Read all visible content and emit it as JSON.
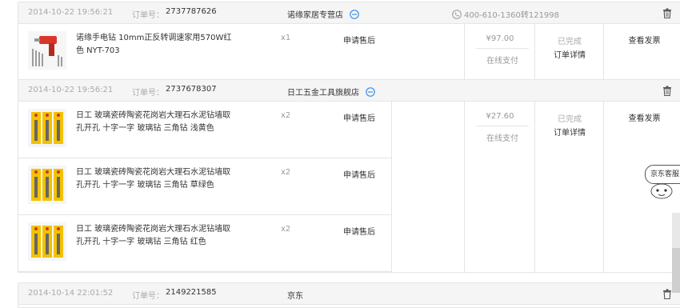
{
  "orders": [
    {
      "time": "2014-10-22 19:56:21",
      "order_label": "订单号：",
      "order_no": "2737787626",
      "shop": "诺缘家居专营店",
      "phone": "400-610-1360转121998",
      "items": [
        {
          "name": "诺缘手电钻 10mm正反转调速家用570W红色 NYT-703",
          "qty": "x1",
          "service": "申请售后"
        }
      ],
      "price": "¥97.00",
      "pay": "在线支付",
      "status": "已完成",
      "detail": "订单详情",
      "invoice": "查看发票"
    },
    {
      "time": "2014-10-22 19:56:21",
      "order_label": "订单号：",
      "order_no": "2737678307",
      "shop": "日工五金工具旗舰店",
      "items": [
        {
          "name": "日工 玻璃瓷砖陶瓷花岗岩大理石水泥钻墙取孔开孔 十字一字 玻璃钻 三角钻 浅黄色",
          "qty": "x2",
          "service": "申请售后"
        },
        {
          "name": "日工 玻璃瓷砖陶瓷花岗岩大理石水泥钻墙取孔开孔 十字一字 玻璃钻 三角钻 草绿色",
          "qty": "x2",
          "service": "申请售后"
        },
        {
          "name": "日工 玻璃瓷砖陶瓷花岗岩大理石水泥钻墙取孔开孔 十字一字 玻璃钻 三角钻 红色",
          "qty": "x2",
          "service": "申请售后"
        }
      ],
      "price": "¥27.60",
      "pay": "在线支付",
      "status": "已完成",
      "detail": "订单详情",
      "invoice": "查看发票"
    },
    {
      "time": "2014-10-14 22:01:52",
      "order_label": "订单号：",
      "order_no": "2149221585",
      "shop": "京东"
    }
  ],
  "kefu": {
    "label": "京东客服"
  },
  "icons": {
    "chat": "chat-bubble-icon",
    "phone": "phone-icon",
    "trash": "trash-icon"
  },
  "colors": {
    "chat_blue": "#3a8ee6",
    "drill_red": "#d9362b",
    "bit_yellow": "#f2c200"
  }
}
